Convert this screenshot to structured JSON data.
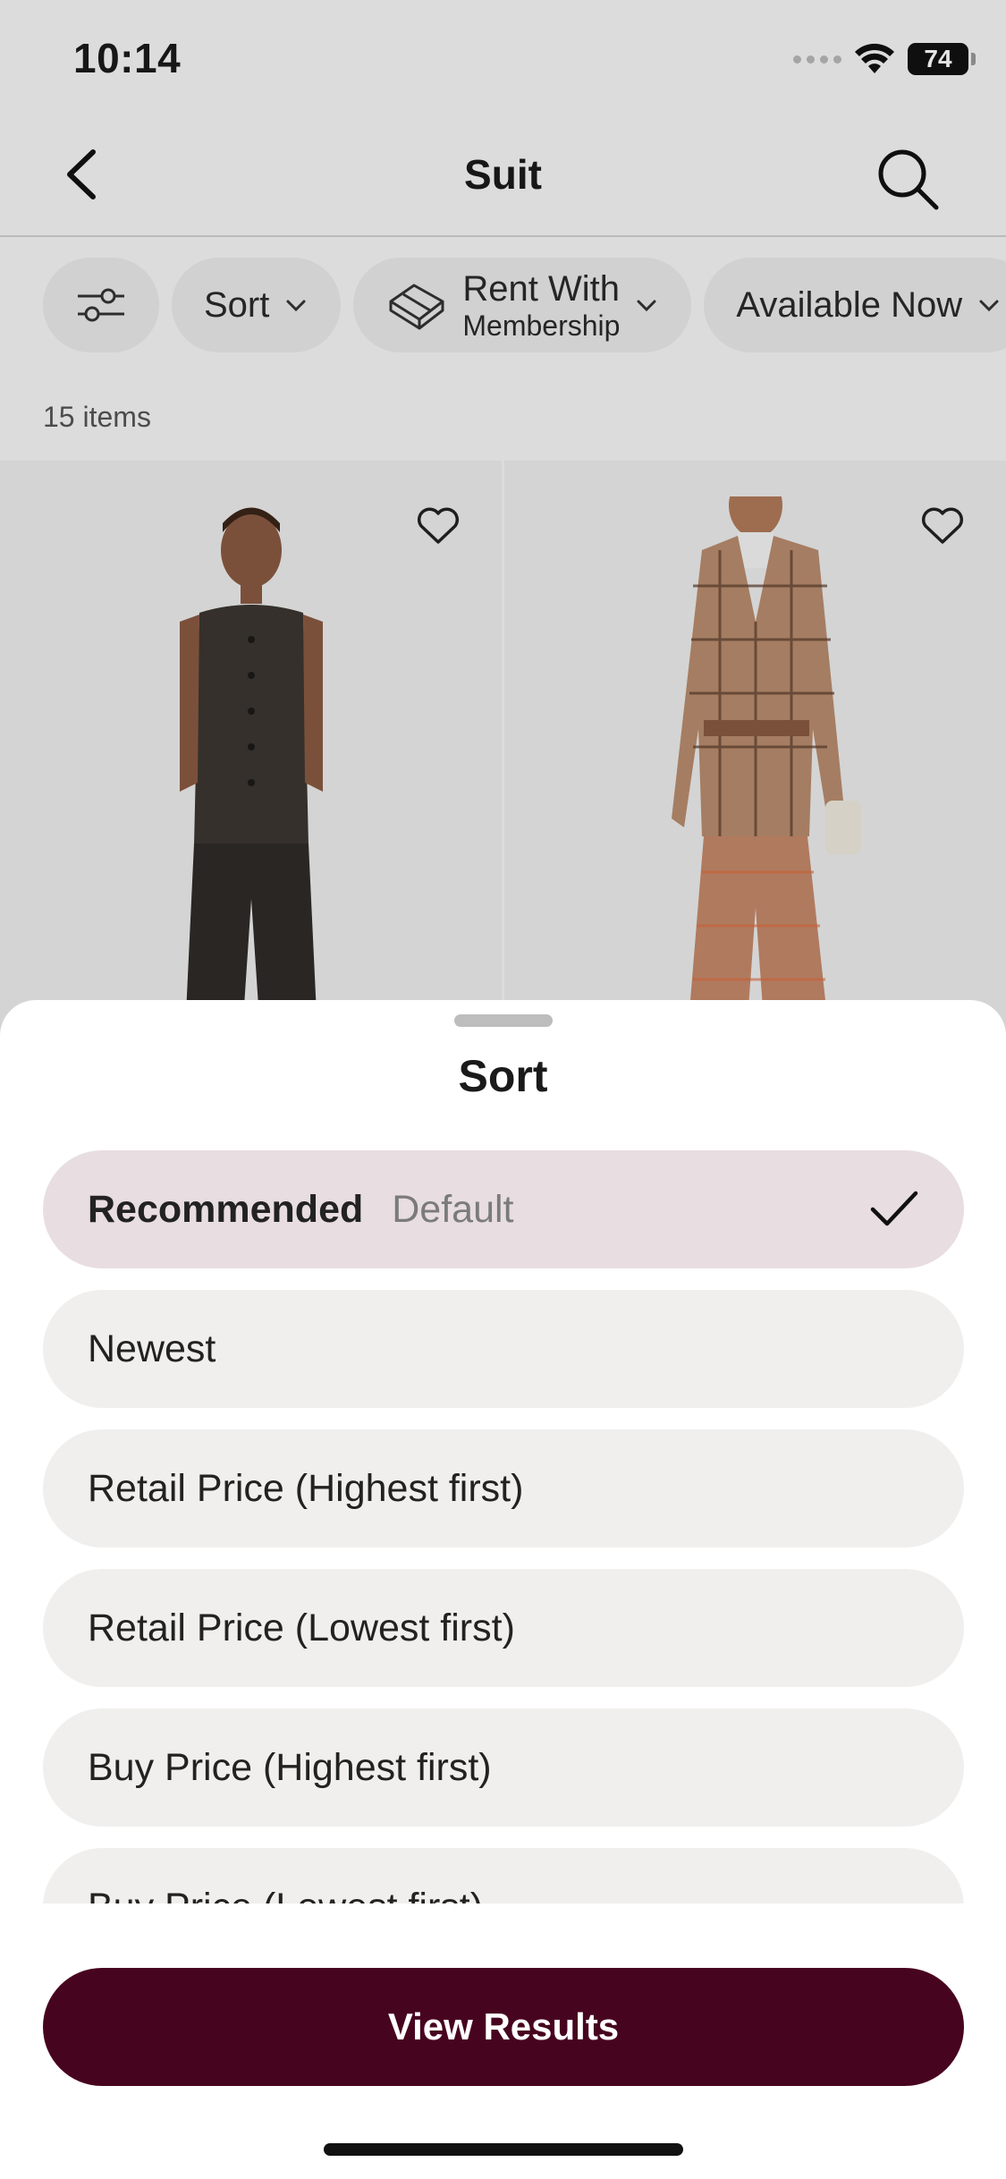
{
  "status_bar": {
    "time": "10:14",
    "battery": "74"
  },
  "navbar": {
    "title": "Suit"
  },
  "filters": {
    "sort_label": "Sort",
    "rent_line1": "Rent With",
    "rent_line2": "Membership",
    "available_label": "Available Now"
  },
  "listing": {
    "item_count": "15 items"
  },
  "sort_sheet": {
    "title": "Sort",
    "options": [
      {
        "label": "Recommended",
        "sub": "Default",
        "selected": true
      },
      {
        "label": "Newest",
        "sub": "",
        "selected": false
      },
      {
        "label": "Retail Price (Highest first)",
        "sub": "",
        "selected": false
      },
      {
        "label": "Retail Price (Lowest first)",
        "sub": "",
        "selected": false
      },
      {
        "label": "Buy Price (Highest first)",
        "sub": "",
        "selected": false
      },
      {
        "label": "Buy Price (Lowest first)",
        "sub": "",
        "selected": false
      }
    ],
    "view_results": "View Results"
  },
  "colors": {
    "accent": "#47041f",
    "selected_option_bg": "#e8dde1",
    "option_bg": "#f0efee"
  },
  "icons": {
    "back": "chevron-left-icon",
    "search": "search-icon",
    "filter": "sliders-icon",
    "rent": "box-icon",
    "favorite": "heart-icon",
    "check": "check-icon"
  }
}
